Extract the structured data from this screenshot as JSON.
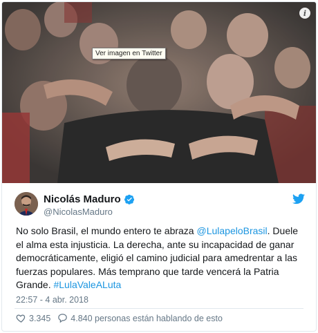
{
  "photo": {
    "tooltip": "Ver imagen en Twitter",
    "info_icon": "i"
  },
  "author": {
    "name": "Nicolás Maduro",
    "handle": "@NicolasMaduro"
  },
  "tweet": {
    "segments": [
      {
        "text": "No solo Brasil, el mundo entero te abraza ",
        "link": false
      },
      {
        "text": "@LulapeloBrasil",
        "link": true
      },
      {
        "text": ". Duele el alma esta injusticia. La derecha, ante su incapacidad de ganar democráticamente, eligió el camino judicial para amedrentar a las fuerzas populares. Más temprano que tarde vencerá la Patria Grande. ",
        "link": false
      },
      {
        "text": "#LulaValeALuta",
        "link": true
      }
    ]
  },
  "timestamp": "22:57 - 4 abr. 2018",
  "stats": {
    "likes": "3.345",
    "replies": "4.840 personas están hablando de esto"
  },
  "colors": {
    "link": "#1b95e0",
    "verified": "#1da1f2",
    "muted": "#657786",
    "border": "#e1e8ed"
  }
}
